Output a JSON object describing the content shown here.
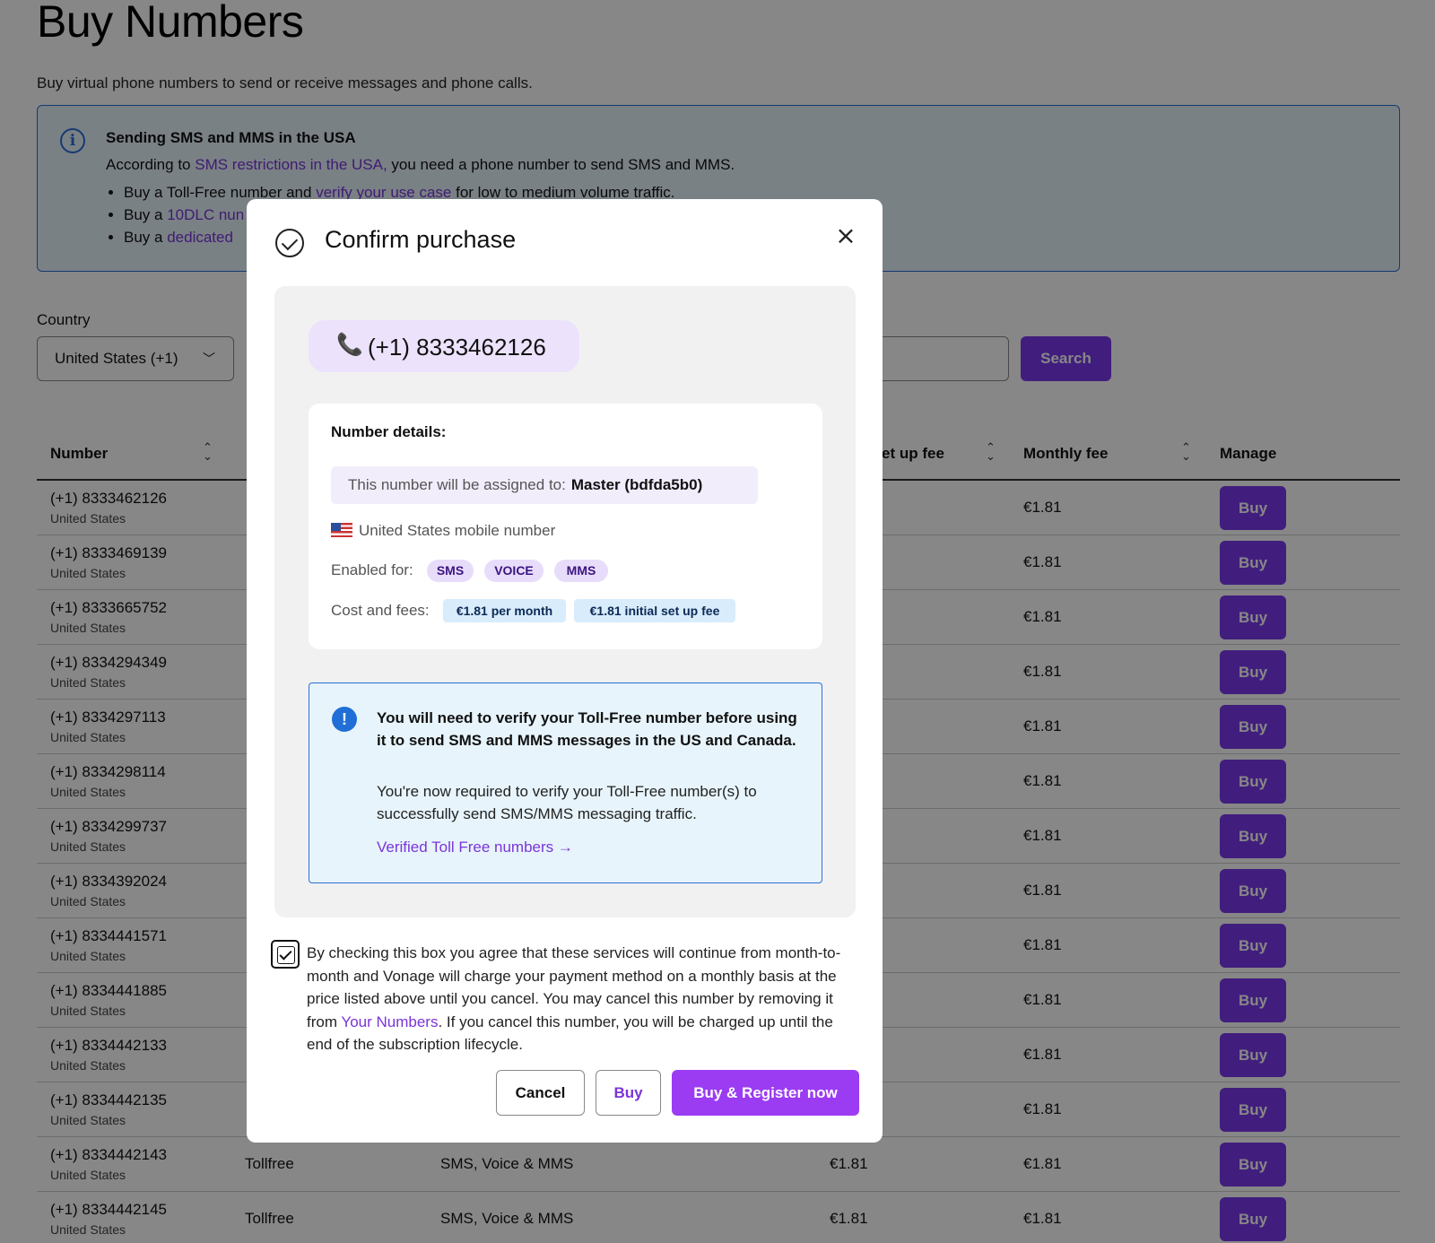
{
  "page": {
    "title": "Buy Numbers",
    "subtitle": "Buy virtual phone numbers to send or receive messages and phone calls."
  },
  "banner": {
    "title": "Sending SMS and MMS in the USA",
    "line_prefix": "According to ",
    "line_link": "SMS restrictions in the USA,",
    "line_suffix": " you need a phone number to send SMS and MMS.",
    "bullets": [
      {
        "prefix": "Buy a Toll-Free number and ",
        "link": "verify your use case",
        "suffix": " for low to medium volume traffic."
      },
      {
        "prefix": "Buy a ",
        "link": "10DLC nun",
        "suffix": ""
      },
      {
        "prefix": "Buy a ",
        "link": "dedicated",
        "suffix": ""
      }
    ]
  },
  "filters": {
    "country_label": "Country",
    "country_value": "United States (+1)",
    "search_button": "Search"
  },
  "table": {
    "headers": {
      "number": "Number",
      "setup_fee": "et up fee",
      "monthly_fee": "Monthly fee",
      "manage": "Manage"
    },
    "buy_label": "Buy",
    "rows": [
      {
        "number": "(+1) 8333462126",
        "country": "United States",
        "type": "",
        "features": "",
        "setup": "",
        "monthly": "€1.81"
      },
      {
        "number": "(+1) 8333469139",
        "country": "United States",
        "type": "",
        "features": "",
        "setup": "",
        "monthly": "€1.81"
      },
      {
        "number": "(+1) 8333665752",
        "country": "United States",
        "type": "",
        "features": "",
        "setup": "",
        "monthly": "€1.81"
      },
      {
        "number": "(+1) 8334294349",
        "country": "United States",
        "type": "",
        "features": "",
        "setup": "",
        "monthly": "€1.81"
      },
      {
        "number": "(+1) 8334297113",
        "country": "United States",
        "type": "",
        "features": "",
        "setup": "",
        "monthly": "€1.81"
      },
      {
        "number": "(+1) 8334298114",
        "country": "United States",
        "type": "",
        "features": "",
        "setup": "",
        "monthly": "€1.81"
      },
      {
        "number": "(+1) 8334299737",
        "country": "United States",
        "type": "",
        "features": "",
        "setup": "",
        "monthly": "€1.81"
      },
      {
        "number": "(+1) 8334392024",
        "country": "United States",
        "type": "",
        "features": "",
        "setup": "",
        "monthly": "€1.81"
      },
      {
        "number": "(+1) 8334441571",
        "country": "United States",
        "type": "",
        "features": "",
        "setup": "",
        "monthly": "€1.81"
      },
      {
        "number": "(+1) 8334441885",
        "country": "United States",
        "type": "",
        "features": "",
        "setup": "",
        "monthly": "€1.81"
      },
      {
        "number": "(+1) 8334442133",
        "country": "United States",
        "type": "",
        "features": "",
        "setup": "",
        "monthly": "€1.81"
      },
      {
        "number": "(+1) 8334442135",
        "country": "United States",
        "type": "",
        "features": "",
        "setup": "",
        "monthly": "€1.81"
      },
      {
        "number": "(+1) 8334442143",
        "country": "United States",
        "type": "Tollfree",
        "features": "SMS, Voice & MMS",
        "setup": "€1.81",
        "monthly": "€1.81"
      },
      {
        "number": "(+1) 8334442145",
        "country": "United States",
        "type": "Tollfree",
        "features": "SMS, Voice & MMS",
        "setup": "€1.81",
        "monthly": "€1.81"
      }
    ]
  },
  "modal": {
    "title": "Confirm purchase",
    "phone_number": "(+1) 8333462126",
    "details_title": "Number details:",
    "assign_label": "This number will be assigned to:",
    "assign_value": "Master (bdfda5b0)",
    "country_text": "United States",
    "number_type_text": "mobile number",
    "enabled_label": "Enabled for:",
    "features": [
      "SMS",
      "VOICE",
      "MMS"
    ],
    "cost_label": "Cost and fees:",
    "fees": [
      "€1.81 per month",
      "€1.81 initial set up fee"
    ],
    "warning_title": "You will need to verify your Toll-Free number before using it to send SMS and MMS messages in the US and Canada.",
    "warning_body": "You're now required to verify your Toll-Free number(s) to successfully send SMS/MMS messaging traffic.",
    "warning_link": "Verified Toll Free numbers →",
    "agree_checked": true,
    "agree_prefix": "By checking this box you agree that these services will continue from month-to-month and Vonage will charge your payment method on a monthly basis at the price listed above until you cancel. You may cancel this number by removing it from ",
    "agree_link": "Your Numbers",
    "agree_suffix": ". If you cancel this number, you will be charged up until the end of the subscription lifecycle.",
    "cancel_label": "Cancel",
    "buy_label": "Buy",
    "register_label": "Buy & Register now"
  },
  "colors": {
    "accent": "#7c3aed",
    "register": "#9b3cf3",
    "info_border": "#2a6fd6",
    "info_bg": "#e6f3fc"
  }
}
